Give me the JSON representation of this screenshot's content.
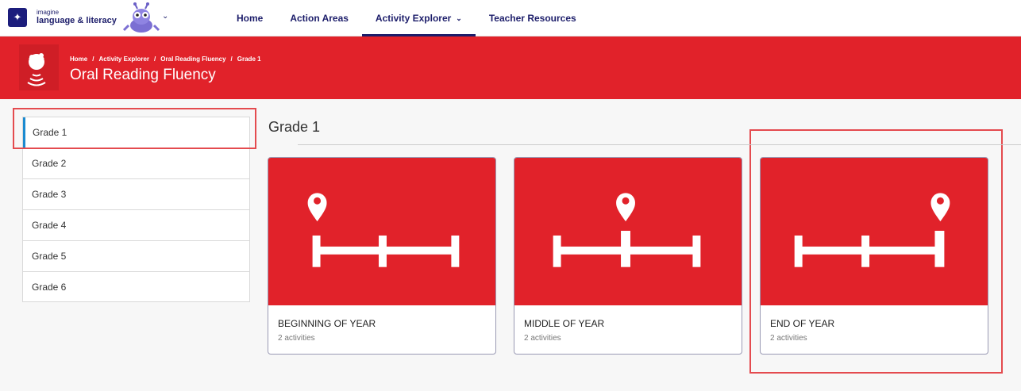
{
  "brand": {
    "small": "imagine",
    "big": "language & literacy",
    "mark_icon": "sparkle-icon",
    "mascot_icon": "robot-mascot-icon"
  },
  "nav": {
    "items": [
      {
        "label": "Home"
      },
      {
        "label": "Action Areas"
      },
      {
        "label": "Activity Explorer",
        "active": true
      },
      {
        "label": "Teacher Resources"
      }
    ]
  },
  "banner": {
    "icon": "child-speaking-icon",
    "breadcrumb": [
      "Home",
      "Activity Explorer",
      "Oral Reading Fluency",
      "Grade 1"
    ],
    "separator": "/",
    "title": "Oral Reading Fluency"
  },
  "sidebar": {
    "items": [
      {
        "label": "Grade 1",
        "selected": true
      },
      {
        "label": "Grade 2"
      },
      {
        "label": "Grade 3"
      },
      {
        "label": "Grade 4"
      },
      {
        "label": "Grade 5"
      },
      {
        "label": "Grade 6"
      }
    ]
  },
  "content": {
    "title": "Grade 1",
    "cards": [
      {
        "title": "BEGINNING OF YEAR",
        "subtitle": "2 activities",
        "icon": "timeline-pin-start-icon"
      },
      {
        "title": "MIDDLE OF YEAR",
        "subtitle": "2 activities",
        "icon": "timeline-pin-middle-icon"
      },
      {
        "title": "END OF YEAR",
        "subtitle": "2 activities",
        "icon": "timeline-pin-end-icon"
      }
    ]
  },
  "colors": {
    "brand_navy": "#1c1d6a",
    "banner_red": "#e1222a",
    "highlight": "#e44b4f",
    "selected_accent": "#1b8ad0"
  }
}
